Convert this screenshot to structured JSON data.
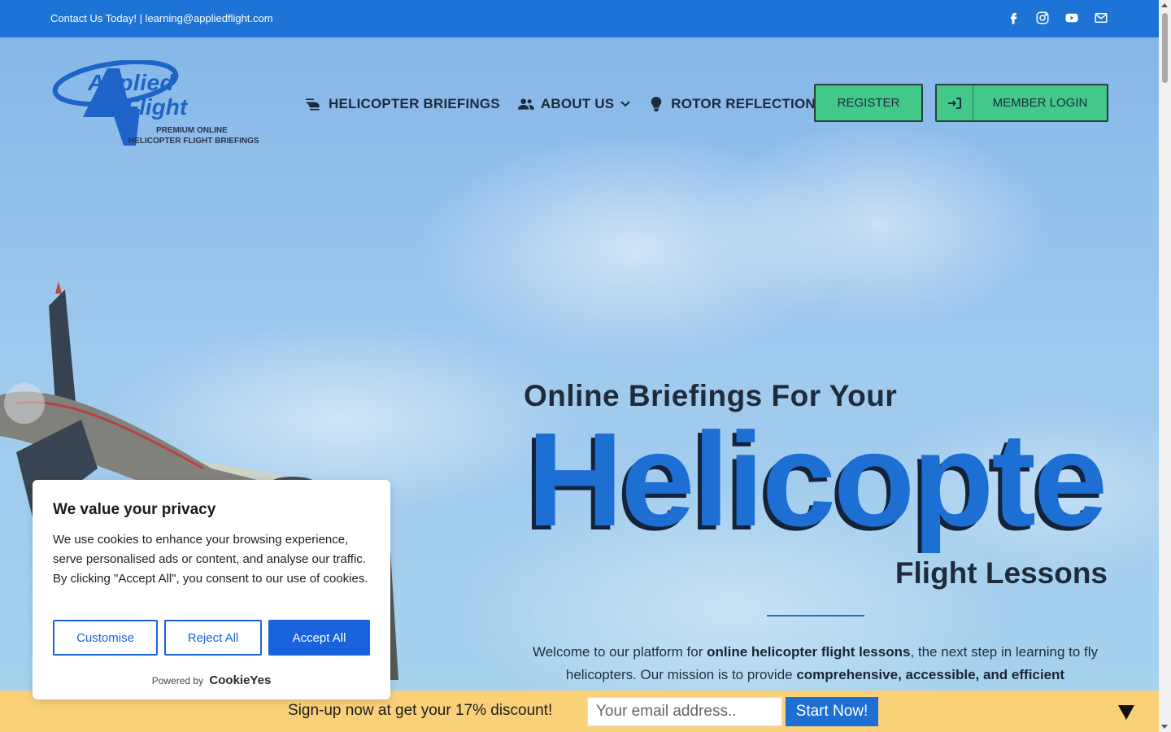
{
  "topbar": {
    "contact": "Contact Us Today! | learning@appliedflight.com",
    "socials": [
      "facebook-icon",
      "instagram-icon",
      "youtube-icon",
      "mail-icon"
    ]
  },
  "logo": {
    "word1": "Applied",
    "word2": "Flight",
    "tagline1": "PREMIUM ONLINE",
    "tagline2": "HELICOPTER FLIGHT BRIEFINGS"
  },
  "nav": {
    "items": [
      {
        "label": "HELICOPTER BRIEFINGS",
        "icon": "helicopter-icon"
      },
      {
        "label": "ABOUT US",
        "icon": "users-icon",
        "has_dropdown": true
      },
      {
        "label": "ROTOR REFLECTIONS",
        "icon": "lightbulb-icon"
      }
    ],
    "register": "REGISTER",
    "login": "MEMBER LOGIN"
  },
  "hero": {
    "line1": "Online Briefings For Your",
    "big": "Helicopte",
    "line3": "Flight Lessons",
    "intro_1": "Welcome to our platform for ",
    "intro_bold1": "online helicopter flight lessons",
    "intro_2": ", the next step in learning to fly helicopters. Our mission is to provide ",
    "intro_bold2": "comprehensive, accessible, and efficient"
  },
  "cookie": {
    "title": "We value your privacy",
    "body": "We use cookies to enhance your browsing experience, serve personalised ads or content, and analyse our traffic. By clicking \"Accept All\", you consent to our use of cookies.",
    "customise": "Customise",
    "reject": "Reject All",
    "accept": "Accept All",
    "powered_by": "Powered by",
    "brand": "CookieYes"
  },
  "signup": {
    "text": "Sign-up now at get your 17% discount!",
    "placeholder": "Your email address..",
    "button": "Start Now!"
  },
  "colors": {
    "brand_blue": "#1e73d6",
    "accent_green": "#43c88a",
    "signup_bg": "#fad179"
  }
}
